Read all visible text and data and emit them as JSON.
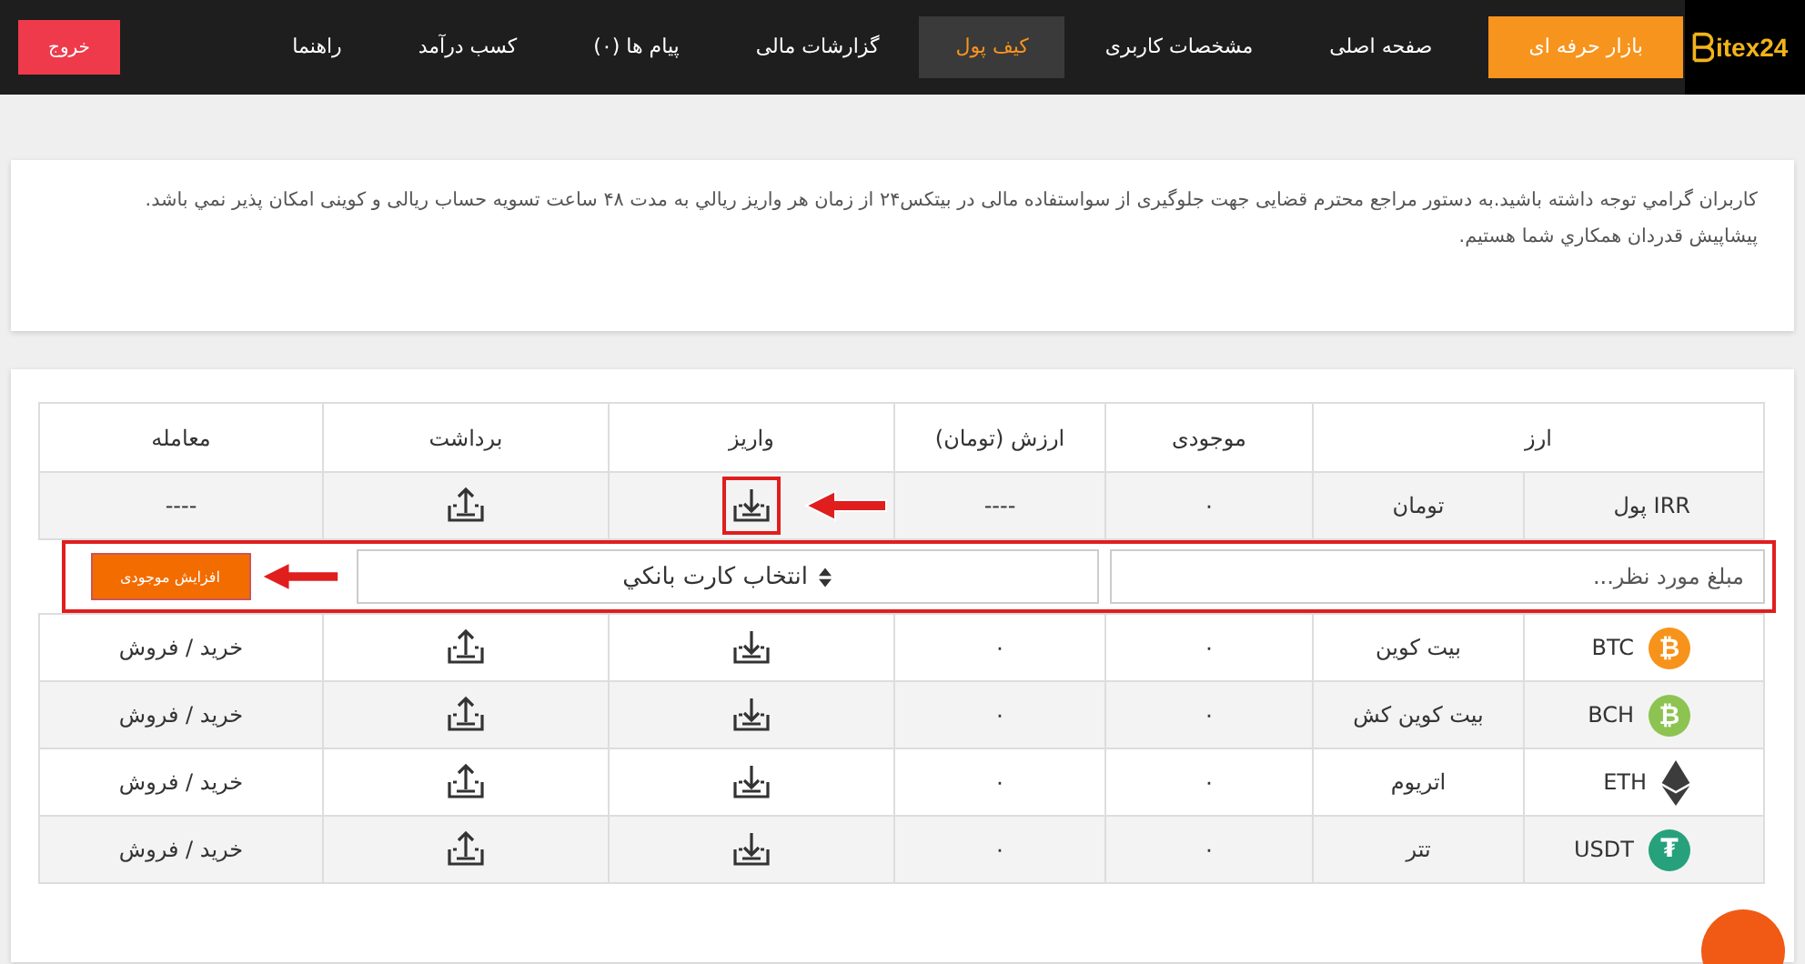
{
  "nav": {
    "logo": "itex24",
    "items": [
      {
        "label": "بازار حرفه ای",
        "kind": "highlight",
        "selected": false
      },
      {
        "label": "صفحه اصلی",
        "kind": "link",
        "selected": false
      },
      {
        "label": "مشخصات کاربری",
        "kind": "link",
        "selected": false
      },
      {
        "label": "کیف پول",
        "kind": "link",
        "selected": true
      },
      {
        "label": "گزارشات مالی",
        "kind": "link",
        "selected": false
      },
      {
        "label": "پیام ها (۰)",
        "kind": "link",
        "selected": false
      },
      {
        "label": "کسب درآمد",
        "kind": "link",
        "selected": false
      },
      {
        "label": "راهنما",
        "kind": "link",
        "selected": false
      }
    ],
    "logout": "خروج"
  },
  "notice": [
    "کاربران گرامي توجه داشته باشید.به دستور مراجع محترم قضایی جهت جلوگیری از سواستفاده مالی در بیتکس۲۴ از زمان هر واریز ریالي به مدت ۴۸ ساعت تسویه حساب ریالی و کوینی امکان پذیر نمي باشد.",
    "پیشاپیش قدردان همکاري شما هستیم."
  ],
  "table": {
    "columns": [
      "ارز",
      "موجودی",
      "ارزش (تومان)",
      "واریز",
      "برداشت",
      "معامله"
    ],
    "rows": [
      {
        "symbol": "پول IRR",
        "name": "تومان",
        "balance": "۰",
        "value": "----",
        "trade": "----",
        "icon": null,
        "deposit_highlighted": true,
        "deposit_form": {
          "placeholder": "مبلغ مورد نظر...",
          "select": "انتخاب کارت بانکي",
          "button": "افزایش موجودی",
          "highlighted": true
        }
      },
      {
        "symbol": "BTC",
        "name": "بیت کوین",
        "balance": "۰",
        "value": "۰",
        "trade": "خرید / فروش",
        "icon": {
          "kind": "coin",
          "glyph": "₿",
          "color": "#f7931a"
        },
        "deposit_highlighted": false
      },
      {
        "symbol": "BCH",
        "name": "بیت کوین کش",
        "balance": "۰",
        "value": "۰",
        "trade": "خرید / فروش",
        "icon": {
          "kind": "coin",
          "glyph": "₿",
          "color": "#8dc351"
        },
        "deposit_highlighted": false
      },
      {
        "symbol": "ETH",
        "name": "اتریوم",
        "balance": "۰",
        "value": "۰",
        "trade": "خرید / فروش",
        "icon": {
          "kind": "diamond",
          "color": "#3c3c3d"
        },
        "deposit_highlighted": false
      },
      {
        "symbol": "USDT",
        "name": "تتر",
        "balance": "۰",
        "value": "۰",
        "trade": "خرید / فروش",
        "icon": {
          "kind": "coin",
          "glyph": "₮",
          "color": "#26a17b"
        },
        "deposit_highlighted": false
      }
    ]
  }
}
